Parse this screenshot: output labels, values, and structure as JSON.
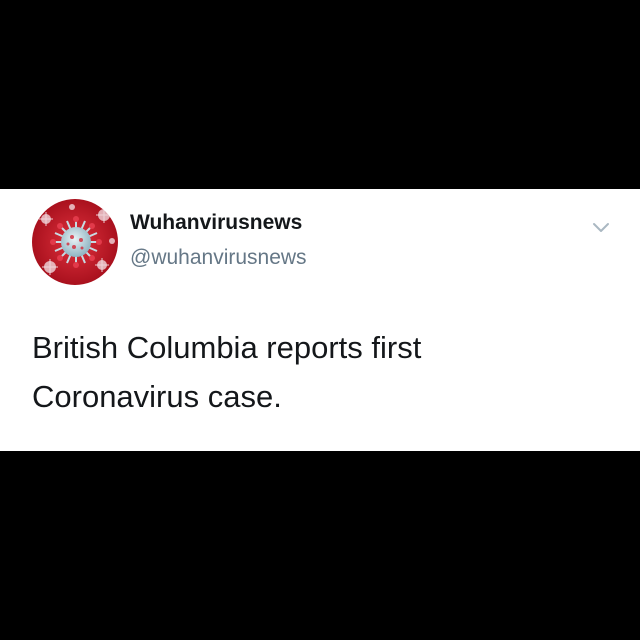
{
  "tweet": {
    "display_name": "Wuhanvirusnews",
    "handle": "@wuhanvirusnews",
    "text_line_1": "British Columbia reports first",
    "text_line_2": "Coronavirus case.",
    "avatar_icon": "coronavirus-icon",
    "menu_icon": "chevron-down-icon"
  },
  "colors": {
    "background": "#000000",
    "card": "#ffffff",
    "name_text": "#14171a",
    "handle_text": "#657786",
    "chevron": "#aab8c2",
    "avatar_bg": "#c1121f"
  }
}
